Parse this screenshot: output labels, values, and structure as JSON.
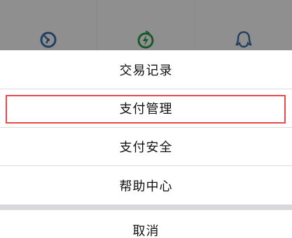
{
  "background": {
    "icons": [
      {
        "name": "ctrip-icon",
        "color": "#3d6fa8"
      },
      {
        "name": "green-energy-icon",
        "color": "#2e9a4a"
      },
      {
        "name": "qq-icon",
        "color": "#3d6fa8"
      }
    ]
  },
  "sheet": {
    "items": [
      {
        "label": "交易记录"
      },
      {
        "label": "支付管理"
      },
      {
        "label": "支付安全"
      },
      {
        "label": "帮助中心"
      }
    ],
    "cancel_label": "取消"
  },
  "highlight_color": "#e8474b"
}
